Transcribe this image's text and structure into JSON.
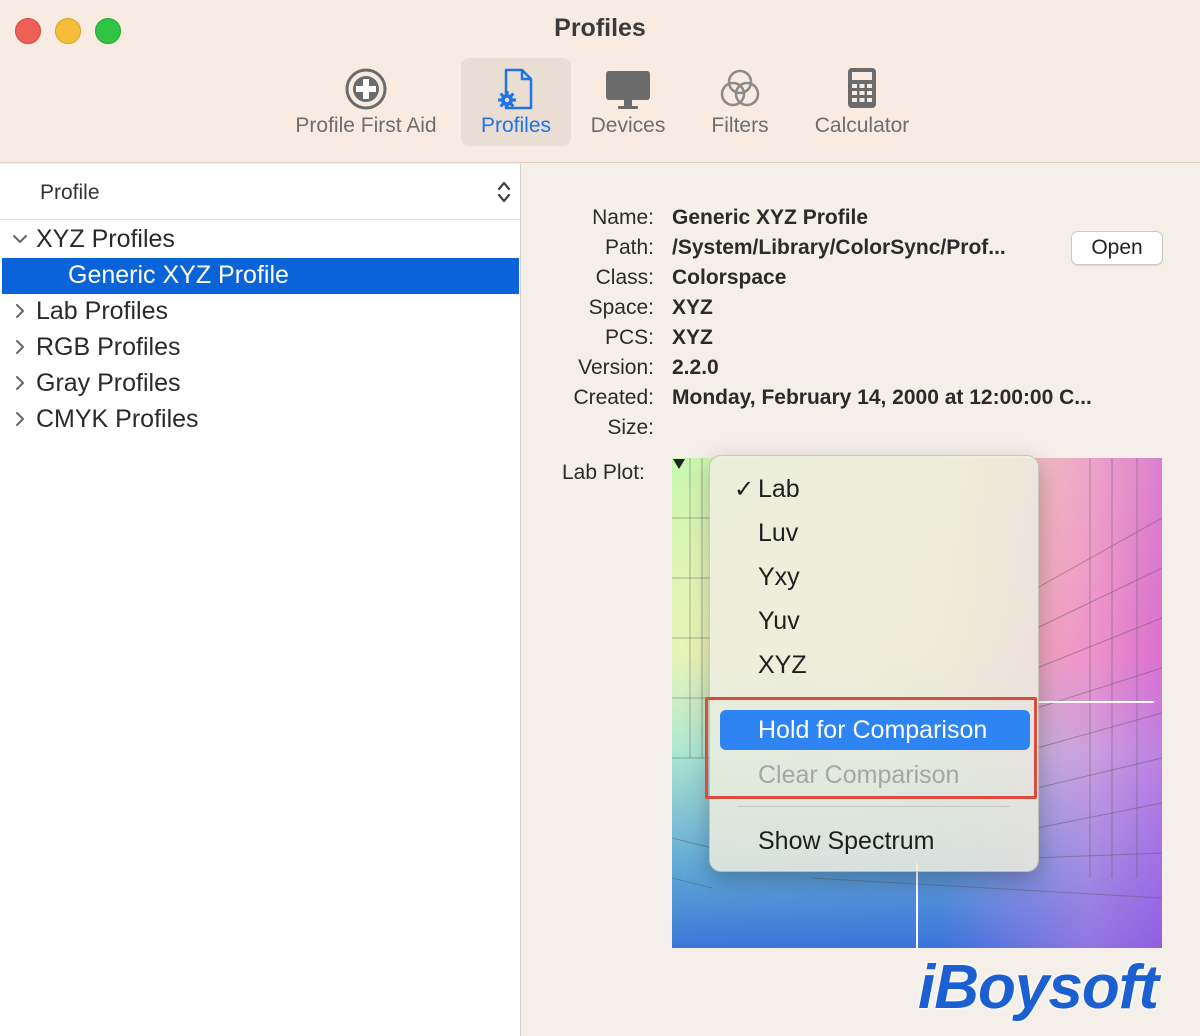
{
  "window": {
    "title": "Profiles"
  },
  "toolbar": {
    "items": [
      {
        "label": "Profile First Aid",
        "icon": "plus-circle-icon"
      },
      {
        "label": "Profiles",
        "icon": "document-gear-icon",
        "active": true
      },
      {
        "label": "Devices",
        "icon": "monitor-icon"
      },
      {
        "label": "Filters",
        "icon": "overlapping-circles-icon"
      },
      {
        "label": "Calculator",
        "icon": "calculator-icon"
      }
    ]
  },
  "sidebar": {
    "header": "Profile",
    "groups": [
      {
        "label": "XYZ Profiles",
        "expanded": true
      },
      {
        "label": "Generic XYZ Profile",
        "selected": true
      },
      {
        "label": "Lab Profiles"
      },
      {
        "label": "RGB Profiles"
      },
      {
        "label": "Gray Profiles"
      },
      {
        "label": "CMYK Profiles"
      }
    ]
  },
  "details": {
    "rows": [
      {
        "key": "Name:",
        "value": "Generic XYZ Profile"
      },
      {
        "key": "Path:",
        "value": "/System/Library/ColorSync/Prof..."
      },
      {
        "key": "Class:",
        "value": "Colorspace"
      },
      {
        "key": "Space:",
        "value": "XYZ"
      },
      {
        "key": "PCS:",
        "value": "XYZ"
      },
      {
        "key": "Version:",
        "value": "2.2.0"
      },
      {
        "key": "Created:",
        "value": "Monday, February 14, 2000 at 12:00:00 C..."
      },
      {
        "key": "Size:",
        "value": ""
      }
    ],
    "open_label": "Open",
    "plot_label": "Lab Plot:"
  },
  "menu": {
    "items": [
      {
        "label": "Lab",
        "checked": true
      },
      {
        "label": "Luv"
      },
      {
        "label": "Yxy"
      },
      {
        "label": "Yuv"
      },
      {
        "label": "XYZ"
      },
      {
        "label": "Hold for Comparison",
        "highlighted": true
      },
      {
        "label": "Clear Comparison",
        "disabled": true
      },
      {
        "label": "Show Spectrum"
      }
    ],
    "check_mark": "✓"
  },
  "watermark": "iBoysoft",
  "colors": {
    "accent": "#0a63d8",
    "highlight": "#2f84f4",
    "annotation": "#dd4b3e"
  }
}
